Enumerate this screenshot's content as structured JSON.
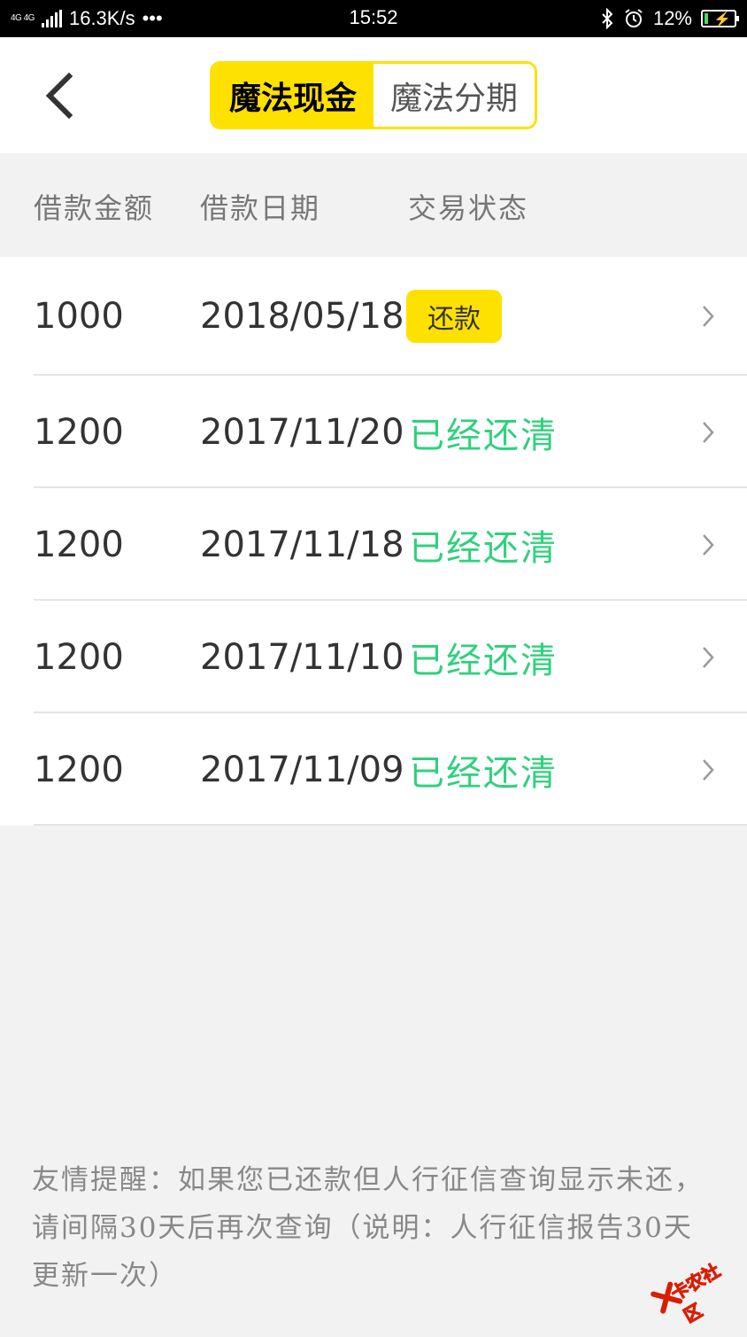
{
  "status_bar": {
    "network": "4G 4G",
    "speed": "16.3K/s",
    "more": "•••",
    "time": "15:52",
    "battery": "12%",
    "battery_level": 0.12,
    "icons": [
      "signal-icon",
      "bluetooth-icon",
      "alarm-icon",
      "battery-icon"
    ]
  },
  "header": {
    "back_icon": "chevron-left-icon",
    "tabs": [
      {
        "label": "魔法现金",
        "active": true
      },
      {
        "label": "魔法分期",
        "active": false
      }
    ]
  },
  "columns": {
    "amount": "借款金额",
    "date": "借款日期",
    "status": "交易状态"
  },
  "loans": [
    {
      "amount": "1000",
      "date": "2018/05/18",
      "status": "还款",
      "status_type": "button"
    },
    {
      "amount": "1200",
      "date": "2017/11/20",
      "status": "已经还清",
      "status_type": "cleared"
    },
    {
      "amount": "1200",
      "date": "2017/11/18",
      "status": "已经还清",
      "status_type": "cleared"
    },
    {
      "amount": "1200",
      "date": "2017/11/10",
      "status": "已经还清",
      "status_type": "cleared"
    },
    {
      "amount": "1200",
      "date": "2017/11/09",
      "status": "已经还清",
      "status_type": "cleared"
    }
  ],
  "note": "友情提醒：如果您已还款但人行征信查询显示未还，请间隔30天后再次查询（说明：人行征信报告30天更新一次）",
  "watermark": {
    "text": "卡农社区",
    "logo_icon": "kanong-logo-icon"
  },
  "colors": {
    "accent": "#ffe100",
    "cleared": "#2fd17d",
    "background": "#f2f2f2"
  }
}
